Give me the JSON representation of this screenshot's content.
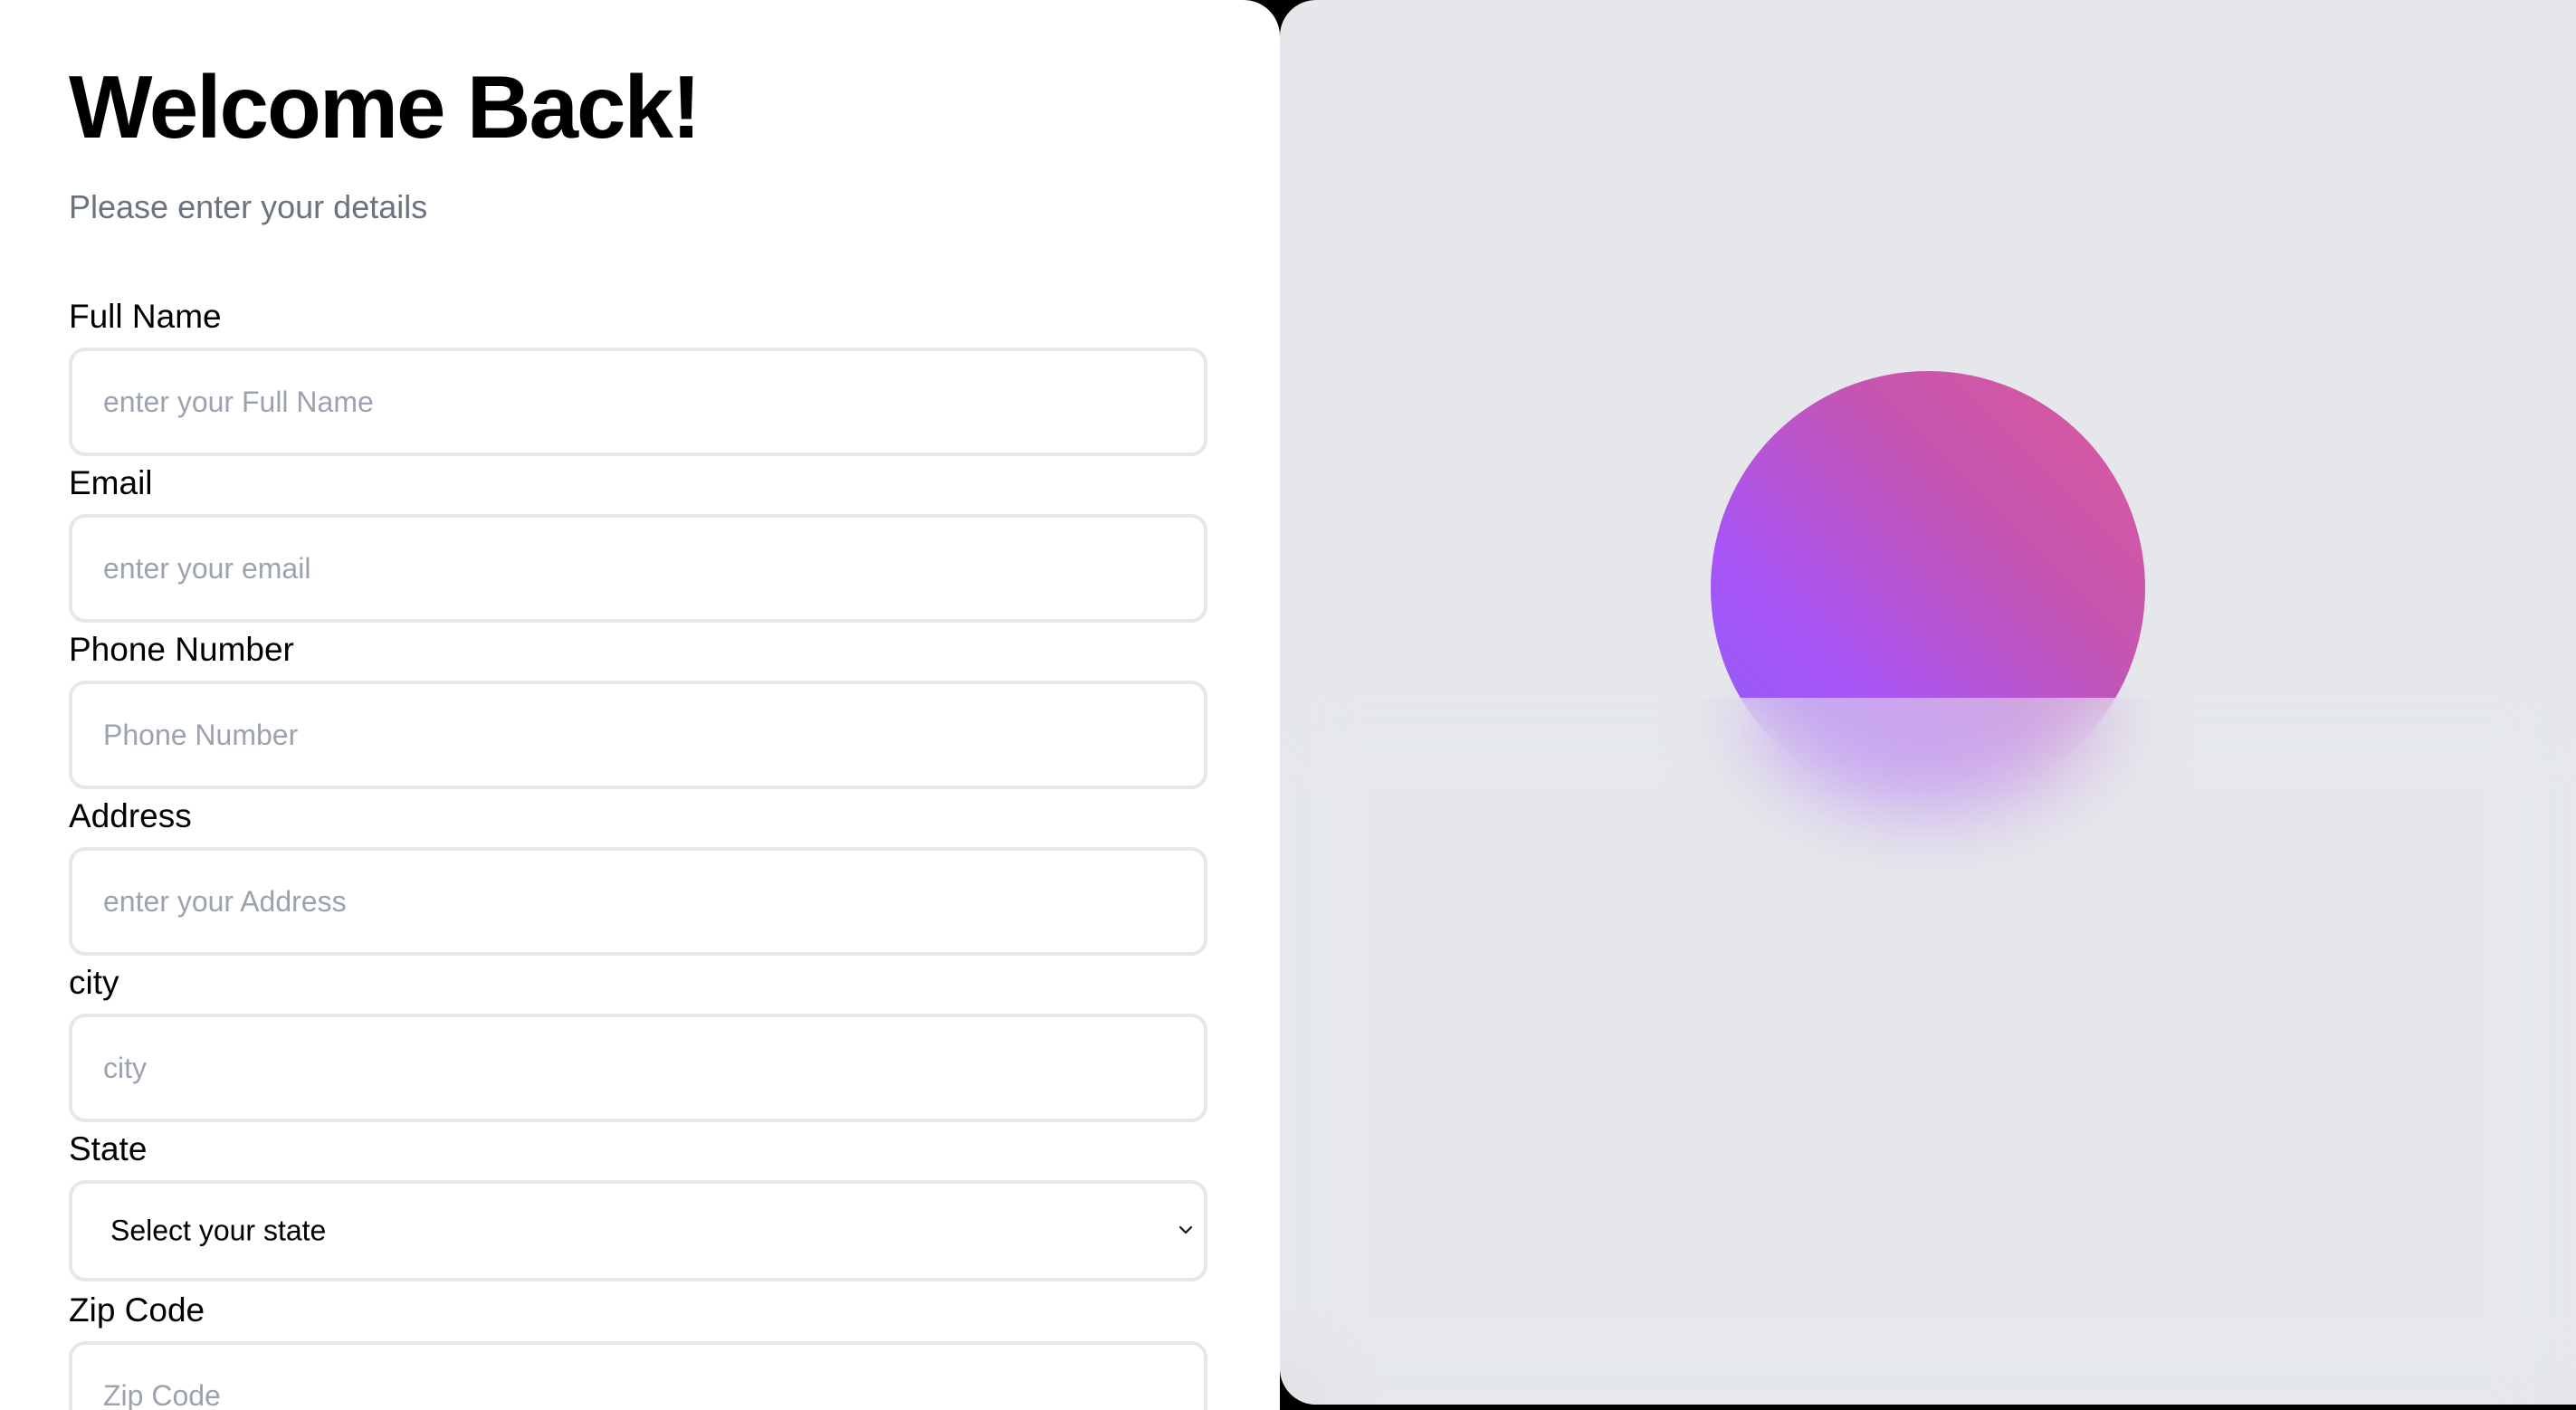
{
  "header": {
    "title": "Welcome Back!",
    "subtitle": "Please enter your details"
  },
  "form": {
    "full_name": {
      "label": "Full Name",
      "placeholder": "enter your Full Name",
      "value": ""
    },
    "email": {
      "label": "Email",
      "placeholder": "enter your email",
      "value": ""
    },
    "phone": {
      "label": "Phone Number",
      "placeholder": "Phone Number",
      "value": ""
    },
    "address": {
      "label": "Address",
      "placeholder": "enter your Address",
      "value": ""
    },
    "city": {
      "label": "city",
      "placeholder": "city",
      "value": ""
    },
    "state": {
      "label": "State",
      "selected": "Select your state"
    },
    "zip": {
      "label": "Zip Code",
      "placeholder": "Zip Code",
      "value": ""
    }
  },
  "icons": {
    "state_select": "chevron-down-icon"
  },
  "colors": {
    "page_background": "#ffffff",
    "panel_background": "#e5e7eb",
    "input_border": "#e5e7eb",
    "subtitle_text": "#6b7280",
    "placeholder_text": "#9ca3af",
    "orb_gradient_start": "#8b5cf6",
    "orb_gradient_end": "#db5a9a"
  }
}
